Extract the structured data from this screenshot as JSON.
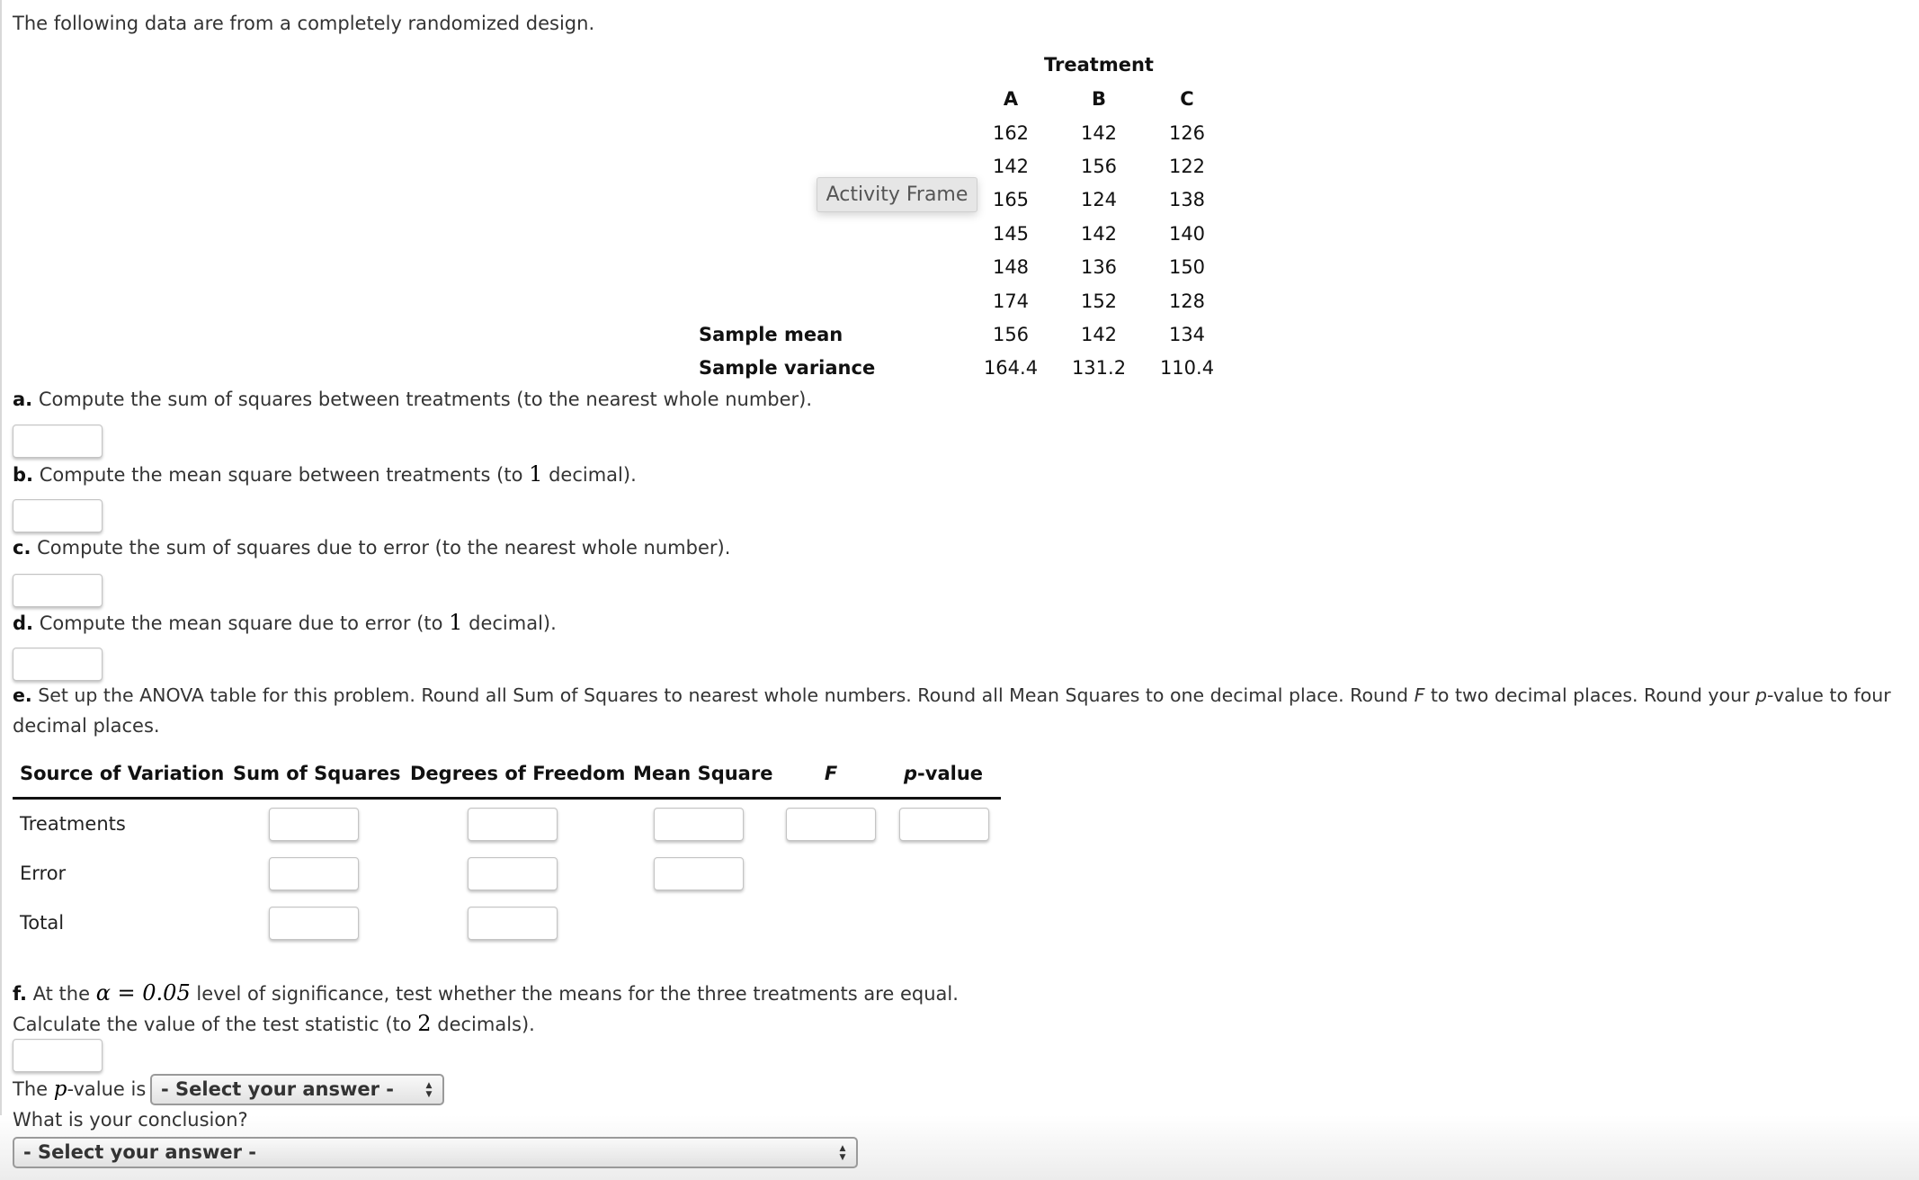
{
  "intro": "The following data are from a completely randomized design.",
  "overlay_button": "Activity Frame",
  "data_table": {
    "group_header": "Treatment",
    "columns": [
      "A",
      "B",
      "C"
    ],
    "rows": [
      [
        "162",
        "142",
        "126"
      ],
      [
        "142",
        "156",
        "122"
      ],
      [
        "165",
        "124",
        "138"
      ],
      [
        "145",
        "142",
        "140"
      ],
      [
        "148",
        "136",
        "150"
      ],
      [
        "174",
        "152",
        "128"
      ]
    ],
    "summary": [
      {
        "label": "Sample mean",
        "values": [
          "156",
          "142",
          "134"
        ]
      },
      {
        "label": "Sample variance",
        "values": [
          "164.4",
          "131.2",
          "110.4"
        ]
      }
    ]
  },
  "questions": {
    "a": {
      "letter": "a.",
      "text": " Compute the sum of squares between treatments (to the nearest whole number).",
      "value": ""
    },
    "b": {
      "letter": "b.",
      "pre": " Compute the mean square between treatments (to ",
      "num": "1",
      "post": " decimal).",
      "value": ""
    },
    "c": {
      "letter": "c.",
      "text": " Compute the sum of squares due to error (to the nearest whole number).",
      "value": ""
    },
    "d": {
      "letter": "d.",
      "pre": " Compute the mean square due to error (to ",
      "num": "1",
      "post": " decimal).",
      "value": ""
    },
    "e": {
      "letter": "e.",
      "t1": " Set up the ANOVA table for this problem. Round all Sum of Squares to nearest whole numbers. Round all Mean Squares to one decimal place. Round ",
      "F": "F",
      "t2": " to two decimal places. Round your ",
      "p": "p",
      "t3": "-value to four",
      "line2": "decimal places."
    },
    "f": {
      "letter": "f.",
      "pre": " At the ",
      "alpha": "α = 0.05",
      "post": " level of significance, test whether the means for the three treatments are equal.",
      "calc_pre": "Calculate the value of the test statistic (to ",
      "calc_num": "2",
      "calc_post": " decimals).",
      "value": "",
      "pvalue_pre": "The ",
      "pvalue_p": "p",
      "pvalue_post": "-value is",
      "pvalue_select": "- Select your answer -",
      "conclusion_label": "What is your conclusion?",
      "conclusion_select": "- Select your answer -"
    }
  },
  "anova": {
    "headers": [
      "Source of Variation",
      "Sum of Squares",
      "Degrees of Freedom",
      "Mean Square",
      "F",
      "p-value"
    ],
    "rows": [
      {
        "label": "Treatments",
        "ss": "",
        "df": "",
        "ms": "",
        "f": "",
        "p": ""
      },
      {
        "label": "Error",
        "ss": "",
        "df": "",
        "ms": ""
      },
      {
        "label": "Total",
        "ss": "",
        "df": ""
      }
    ]
  }
}
